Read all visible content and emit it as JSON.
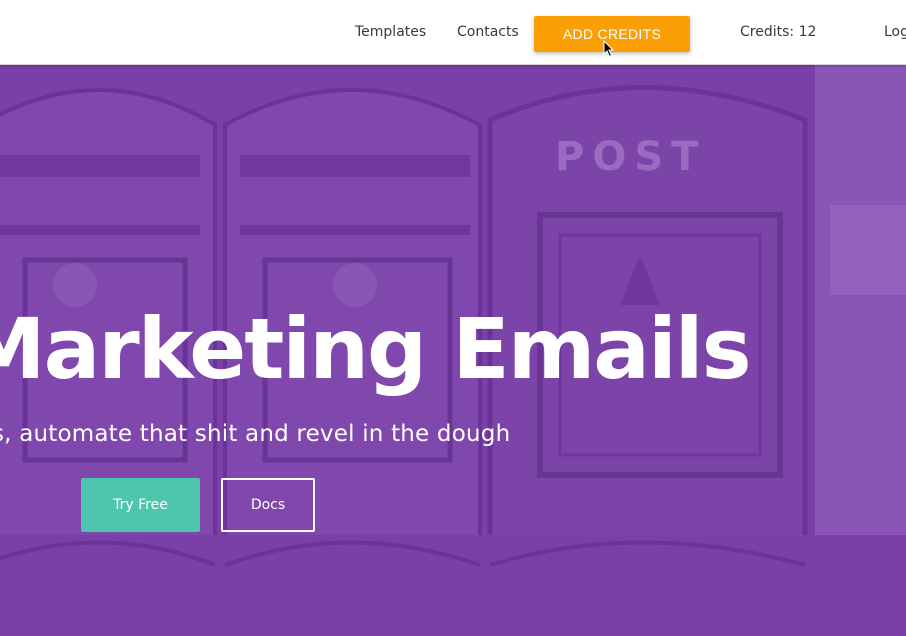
{
  "navbar": {
    "links": {
      "templates": "Templates",
      "contacts": "Contacts",
      "log": "Log"
    },
    "add_credits_label": "ADD CREDITS",
    "credits_text": "Credits: 12"
  },
  "hero": {
    "title": "Marketing Emails",
    "subtitle": "s, automate that shit and revel in the dough",
    "try_free_label": "Try Free",
    "docs_label": "Docs",
    "background_text": "POST"
  },
  "colors": {
    "hero_purple": "#7a3fa8",
    "add_credits_orange": "#fb9f06",
    "try_free_teal": "#4ec6ad",
    "navbar_white": "#ffffff"
  },
  "icons": {
    "cursor": "arrow-cursor-icon"
  }
}
